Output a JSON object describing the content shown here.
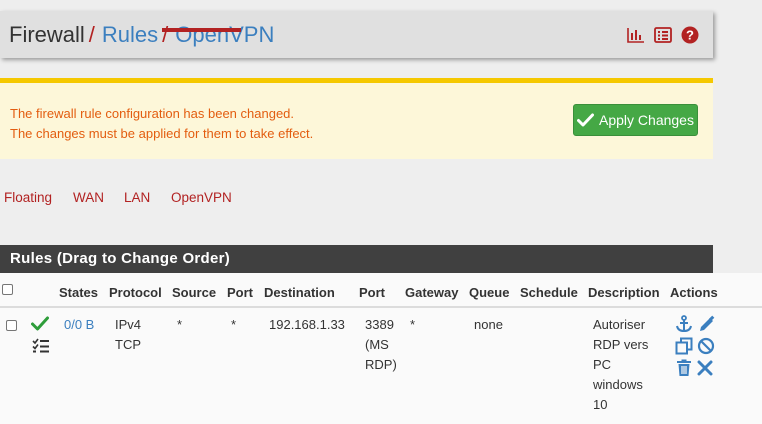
{
  "breadcrumb": {
    "first": "Firewall",
    "second": "Rules",
    "third": "OpenVPN",
    "separator": "/"
  },
  "header_icons": [
    "chart-icon",
    "list-icon",
    "help-icon"
  ],
  "notice": {
    "line1": "The firewall rule configuration has been changed.",
    "line2": "The changes must be applied for them to take effect.",
    "apply_label": "Apply Changes"
  },
  "tabs": [
    {
      "label": "Floating",
      "active": false
    },
    {
      "label": "WAN",
      "active": false
    },
    {
      "label": "LAN",
      "active": false
    },
    {
      "label": "OpenVPN",
      "active": true
    }
  ],
  "panel": {
    "title": "Rules (Drag to Change Order)",
    "columns": [
      "States",
      "Protocol",
      "Source",
      "Port",
      "Destination",
      "Port",
      "Gateway",
      "Queue",
      "Schedule",
      "Description",
      "Actions"
    ]
  },
  "rows": [
    {
      "states": "0/0 B",
      "protocol_line1": "IPv4",
      "protocol_line2": "TCP",
      "source": "*",
      "source_port": "*",
      "destination": "192.168.1.33",
      "dest_port_line1": "3389",
      "dest_port_line2": "(MS",
      "dest_port_line3": "RDP)",
      "gateway": "*",
      "queue": "none",
      "schedule": "",
      "description_lines": [
        "Autoriser",
        "RDP vers",
        "PC",
        "windows",
        "10"
      ],
      "status_icon": "check-icon",
      "row_icon": "list-icon",
      "action_icons": [
        "anchor-icon",
        "pencil-icon",
        "copy-icon",
        "disable-icon",
        "trash-icon",
        "delete-x-icon"
      ]
    }
  ],
  "colors": {
    "link": "#3b7fbf",
    "tab_red": "#b22222",
    "notice_text": "#e35d10",
    "apply_green": "#45a845",
    "panel_dark": "#404040"
  }
}
